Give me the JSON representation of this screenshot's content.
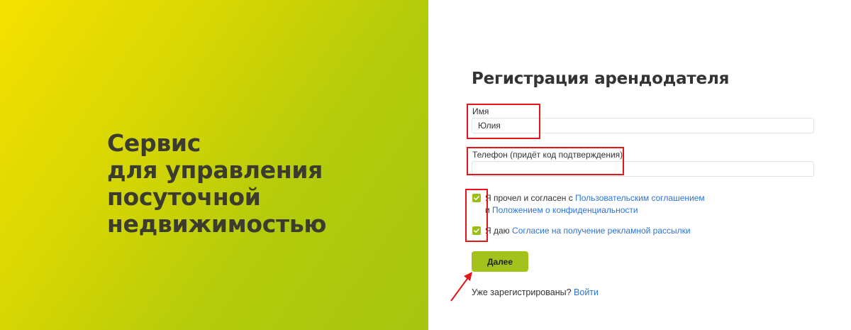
{
  "hero": {
    "lines": [
      "Сервис",
      "для управления",
      "посуточной",
      "недвижимостью"
    ]
  },
  "form": {
    "title": "Регистрация арендодателя",
    "name": {
      "label": "Имя",
      "value": "Юлия"
    },
    "phone": {
      "label": "Телефон (придёт код подтверждения)",
      "value": ""
    },
    "agreement1": {
      "checked": true,
      "prefix": "Я прочел и согласен с",
      "link_terms": "Пользовательским соглашением",
      "conjunction": "и",
      "link_privacy": "Положением о конфиденциальности"
    },
    "agreement2": {
      "checked": true,
      "prefix": "Я даю",
      "link": "Согласие на получение рекламной рассылки"
    },
    "submit_label": "Далее",
    "login_prompt": "Уже зарегистрированы?",
    "login_link": "Войти"
  },
  "colors": {
    "accent": "#a3c21b",
    "link": "#2d74d6",
    "annotation": "#e2161b",
    "gradient_start": "#f6e100",
    "gradient_end": "#a7c610"
  }
}
